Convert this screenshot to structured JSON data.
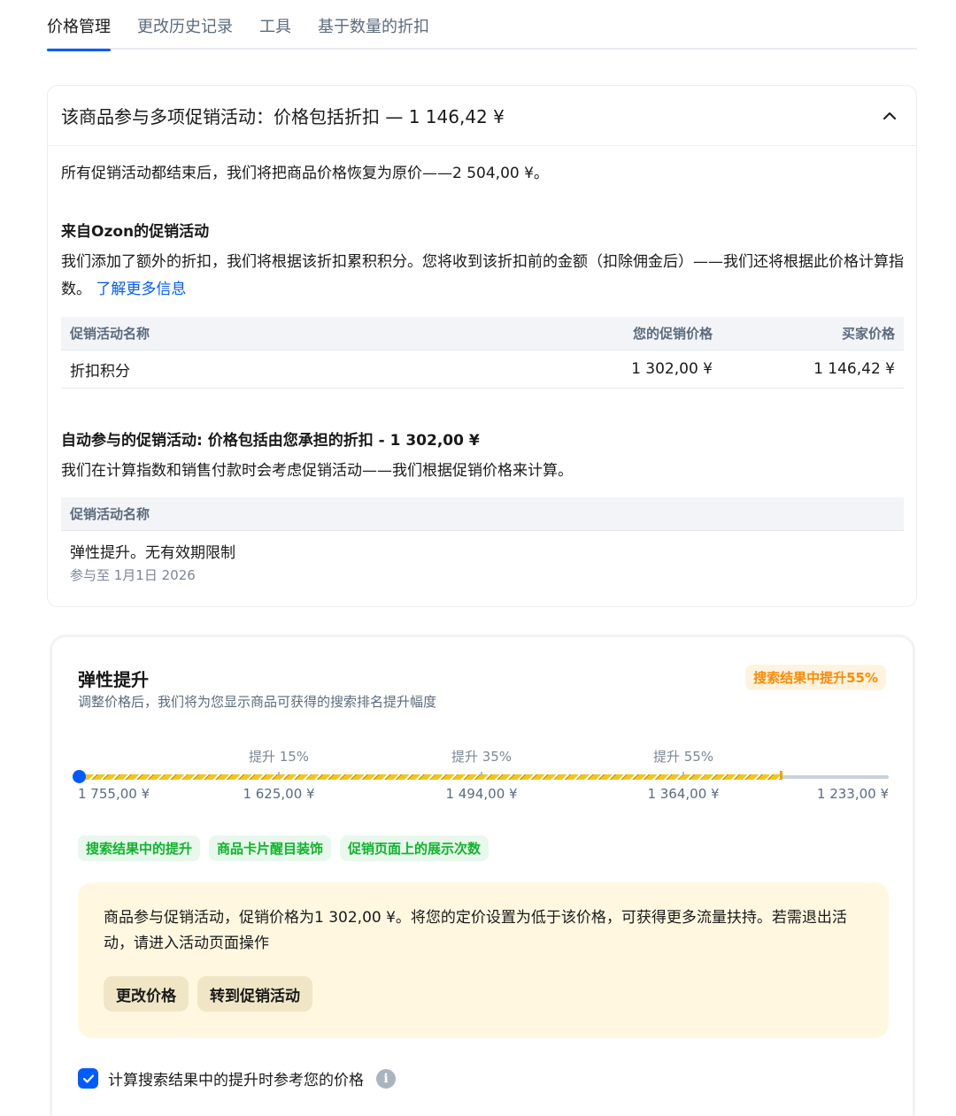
{
  "tabs": [
    {
      "label": "价格管理",
      "active": true
    },
    {
      "label": "更改历史记录",
      "active": false
    },
    {
      "label": "工具",
      "active": false
    },
    {
      "label": "基于数量的折扣",
      "active": false
    }
  ],
  "promo_card": {
    "title": "该商品参与多项促销活动：价格包括折扣 — 1 146,42 ¥",
    "restore_text": "所有促销活动都结束后，我们将把商品价格恢复为原价——2 504,00 ¥。",
    "ozon": {
      "heading": "来自Ozon的促销活动",
      "text": "我们添加了额外的折扣，我们将根据该折扣累积积分。您将收到该折扣前的金额（扣除佣金后）——我们还将根据此价格计算指数。",
      "link": "了解更多信息",
      "table": {
        "headers": [
          "促销活动名称",
          "您的促销价格",
          "买家价格"
        ],
        "rows": [
          {
            "name": "折扣积分",
            "promo_price": "1 302,00 ¥",
            "buyer_price": "1 146,42 ¥"
          }
        ]
      }
    },
    "auto": {
      "heading": "自动参与的促销活动: 价格包括由您承担的折扣 - 1 302,00 ¥",
      "text": "我们在计算指数和销售付款时会考虑促销活动——我们根据促销价格来计算。",
      "table": {
        "header": "促销活动名称",
        "rows": [
          {
            "name": "弹性提升。无有效期限制",
            "until": "参与至 1月1日 2026"
          }
        ]
      }
    }
  },
  "boost_card": {
    "title": "弹性提升",
    "subtitle": "调整价格后，我们将为您显示商品可获得的搜索排名提升幅度",
    "badge": "搜索结果中提升55%",
    "slider": {
      "tick_labels": [
        "提升 15%",
        "提升 35%",
        "提升 55%"
      ],
      "prices": [
        "1 755,00 ¥",
        "1 625,00 ¥",
        "1 494,00 ¥",
        "1 364,00 ¥",
        "1 233,00 ¥"
      ]
    },
    "chips": [
      "搜索结果中的提升",
      "商品卡片醒目装饰",
      "促销页面上的展示次数"
    ],
    "notice": {
      "text": "商品参与促销活动，促销价格为1 302,00 ¥。将您的定价设置为低于该价格，可获得更多流量扶持。若需退出活动，请进入活动页面操作",
      "buttons": [
        "更改价格",
        "转到促销活动"
      ]
    },
    "checkbox": {
      "label": "计算搜索结果中的提升时参考您的价格",
      "checked": true
    },
    "info_glyph": "i"
  }
}
